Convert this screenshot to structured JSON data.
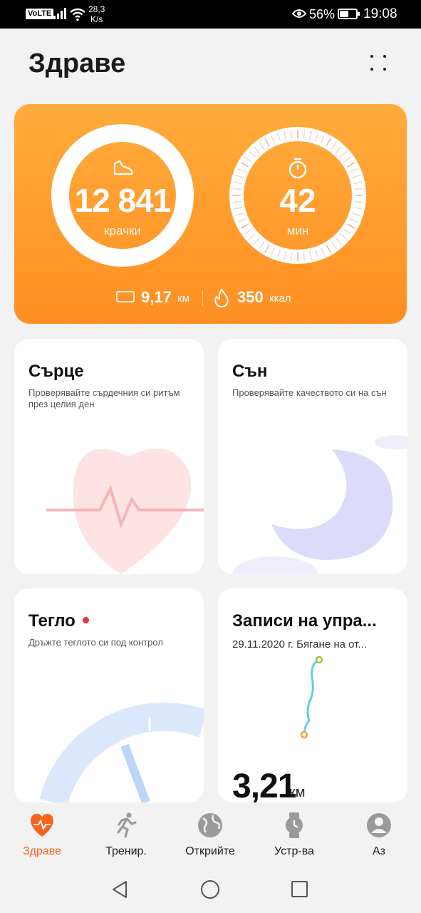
{
  "status_bar": {
    "volte": "VoLTE",
    "net_speed_value": "28,3",
    "net_speed_unit": "K/s",
    "battery_percent": "56%",
    "battery_level": 0.56,
    "time": "19:08"
  },
  "header": {
    "title": "Здраве"
  },
  "activity": {
    "steps_value": "12 841",
    "steps_unit": "крачки",
    "minutes_value": "42",
    "minutes_unit": "мин",
    "distance_value": "9,17",
    "distance_unit": "км",
    "calories_value": "350",
    "calories_unit": "ккал",
    "accent_color": "#ff9a2e"
  },
  "tiles": {
    "heart": {
      "title": "Сърце",
      "subtitle": "Проверявайте сърдечния си ритъм през целия ден"
    },
    "sleep": {
      "title": "Сън",
      "subtitle": "Проверявайте качеството си на сън"
    },
    "weight": {
      "title": "Тегло",
      "subtitle": "Дръжте теглото си под контрол"
    },
    "exercise": {
      "title": "Записи на упра...",
      "subtitle": "29.11.2020 г.  Бягане на от...",
      "value": "3,21",
      "unit": "км"
    }
  },
  "bottom_nav": {
    "active_color": "#f5631e",
    "items": [
      {
        "label": "Здраве",
        "icon": "heart-icon"
      },
      {
        "label": "Тренир.",
        "icon": "runner-icon"
      },
      {
        "label": "Открийте",
        "icon": "globe-icon"
      },
      {
        "label": "Устр-ва",
        "icon": "watch-icon"
      },
      {
        "label": "Аз",
        "icon": "profile-icon"
      }
    ]
  }
}
